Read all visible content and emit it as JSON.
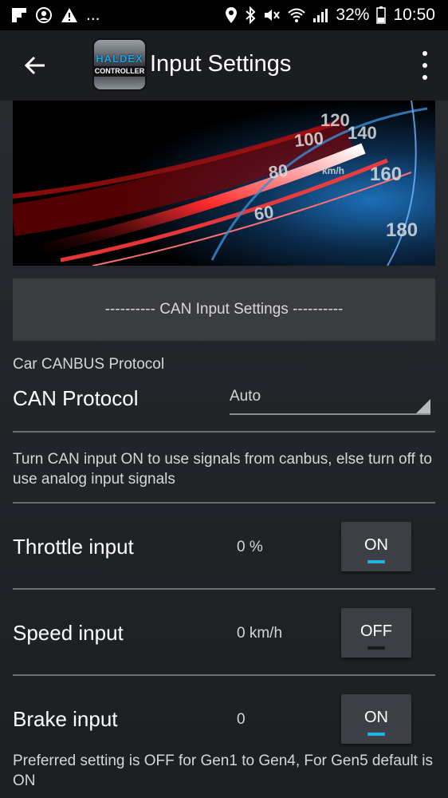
{
  "status_bar": {
    "left_icons": [
      "flipboard-icon",
      "account-circle-icon",
      "warning-icon"
    ],
    "more": "...",
    "right_icons": [
      "location-icon",
      "bluetooth-icon",
      "mute-icon",
      "wifi-icon",
      "signal-icon"
    ],
    "battery": "32%",
    "time": "10:50"
  },
  "app_bar": {
    "logo_top": "HALDEX",
    "logo_bottom": "CONTROLLER",
    "title": "Input Settings"
  },
  "banner": {
    "numbers": [
      "60",
      "80",
      "100",
      "120",
      "140",
      "160",
      "180",
      "km/h"
    ]
  },
  "section": {
    "header": "---------- CAN Input Settings ----------"
  },
  "protocol": {
    "group_label": "Car CANBUS Protocol",
    "label": "CAN Protocol",
    "selected": "Auto"
  },
  "description": "Turn CAN input ON to use signals from canbus, else turn off to use analog input signals",
  "inputs": [
    {
      "label": "Throttle input",
      "value": "0 %",
      "toggle": "ON"
    },
    {
      "label": "Speed input",
      "value": "0 km/h",
      "toggle": "OFF"
    },
    {
      "label": "Brake input",
      "value": "0",
      "toggle": "ON"
    }
  ],
  "footer_note": "Preferred setting is OFF for Gen1 to Gen4, For Gen5 default is ON",
  "colors": {
    "accent": "#1fb3e6",
    "toggle_off_indicator": "#1a1a1a"
  }
}
